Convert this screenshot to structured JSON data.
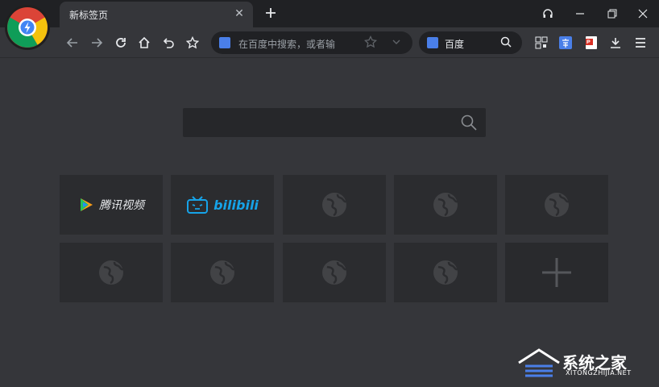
{
  "tab": {
    "title": "新标签页"
  },
  "address_bar": {
    "placeholder": "在百度中搜索，或者输"
  },
  "search_engine": {
    "name": "百度"
  },
  "tiles": [
    {
      "label": "腾讯视频",
      "type": "brand"
    },
    {
      "label": "bilibili",
      "type": "bili"
    },
    {
      "label": "",
      "type": "globe"
    },
    {
      "label": "",
      "type": "globe"
    },
    {
      "label": "",
      "type": "globe"
    },
    {
      "label": "",
      "type": "globe"
    },
    {
      "label": "",
      "type": "globe"
    },
    {
      "label": "",
      "type": "globe"
    },
    {
      "label": "",
      "type": "globe"
    },
    {
      "label": "",
      "type": "add"
    }
  ],
  "watermark": {
    "name": "系统之家",
    "url": "XITONGZHIJIA.NET"
  },
  "colors": {
    "background": "#35363a",
    "titlebar": "#202124",
    "tile": "#2b2c2f",
    "accent": "#4a7fe8",
    "bili": "#16a3e8"
  }
}
